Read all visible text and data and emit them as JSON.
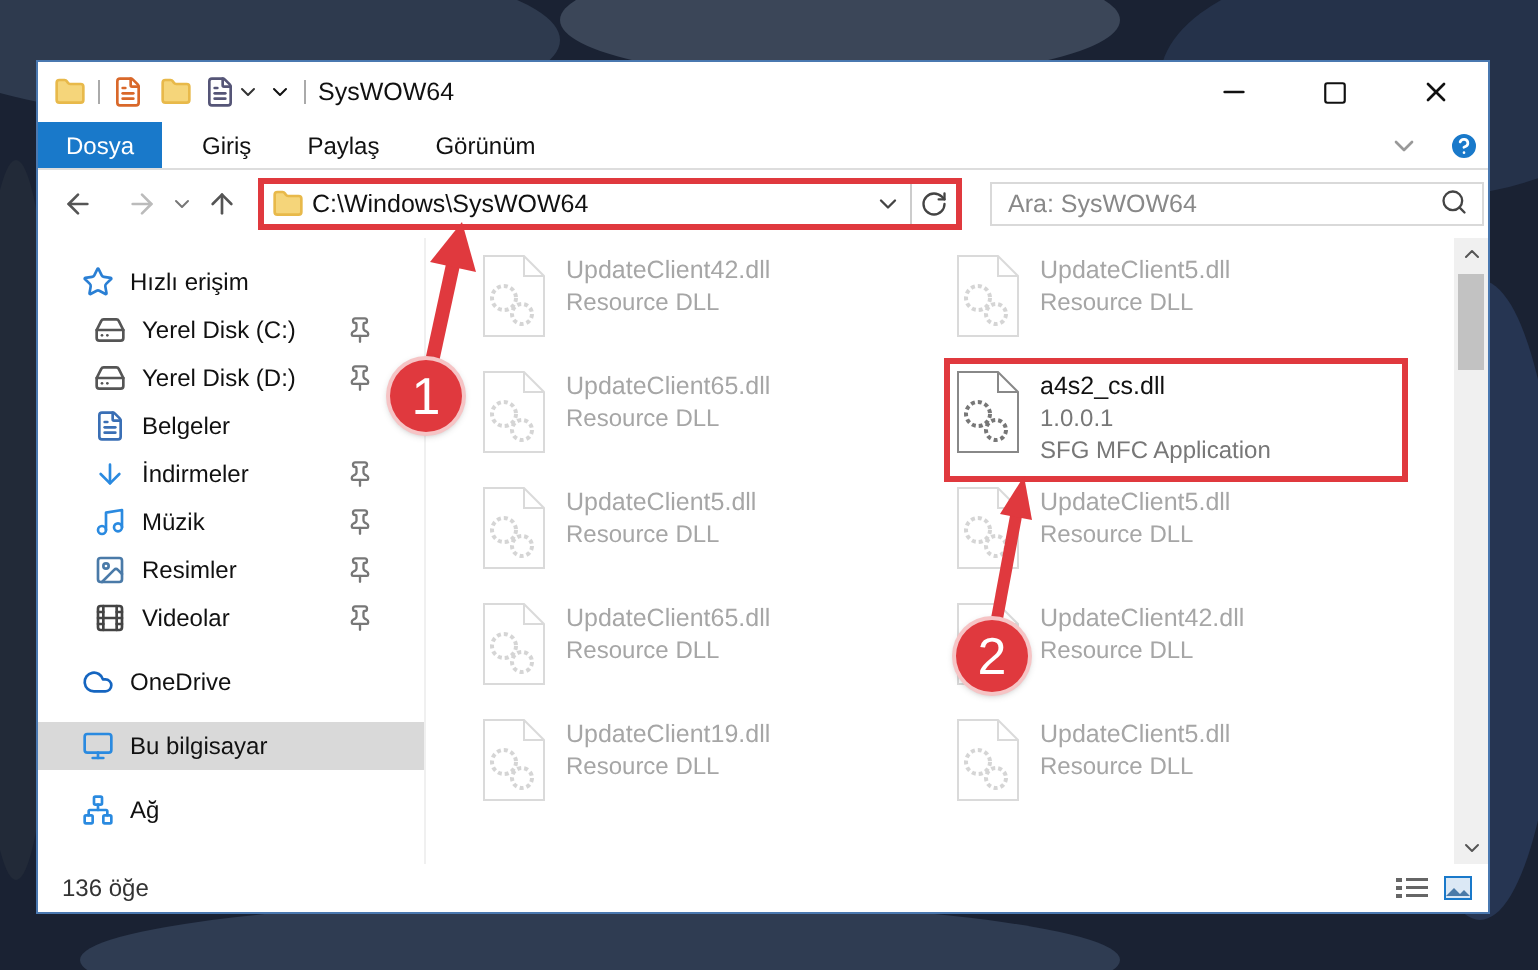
{
  "window": {
    "title": "SysWOW64"
  },
  "ribbon_tabs": [
    {
      "label": "Dosya",
      "selected": true
    },
    {
      "label": "Giriş",
      "selected": false
    },
    {
      "label": "Paylaş",
      "selected": false
    },
    {
      "label": "Görünüm",
      "selected": false
    }
  ],
  "address_bar": {
    "path": "C:\\Windows\\SysWOW64",
    "highlighted": true
  },
  "search": {
    "placeholder": "Ara: SysWOW64"
  },
  "sidebar": {
    "items": [
      {
        "label": "Hızlı erişim",
        "selected": false,
        "children": [
          {
            "label": "Yerel Disk (C:)",
            "pinned": true
          },
          {
            "label": "Yerel Disk (D:)",
            "pinned": true
          },
          {
            "label": "Belgeler"
          },
          {
            "label": "İndirmeler",
            "pinned": true
          },
          {
            "label": "Müzik",
            "pinned": true
          },
          {
            "label": "Resimler",
            "pinned": true
          },
          {
            "label": "Videolar",
            "pinned": true
          }
        ]
      },
      {
        "label": "OneDrive",
        "selected": false
      },
      {
        "label": "Bu bilgisayar",
        "selected": true
      },
      {
        "label": "Ağ",
        "selected": false
      }
    ]
  },
  "files": [
    {
      "name": "UpdateClient42.dll",
      "description": "Resource DLL",
      "faded": true,
      "highlighted": false
    },
    {
      "name": "UpdateClient5.dll",
      "description": "Resource DLL",
      "faded": true,
      "highlighted": false
    },
    {
      "name": "UpdateClient65.dll",
      "description": "Resource DLL",
      "faded": true,
      "highlighted": false
    },
    {
      "name": "a4s2_cs.dll",
      "version": "1.0.0.1",
      "description": "SFG MFC Application",
      "faded": false,
      "highlighted": true
    },
    {
      "name": "UpdateClient5.dll",
      "description": "Resource DLL",
      "faded": true,
      "highlighted": false
    },
    {
      "name": "UpdateClient5.dll",
      "description": "Resource DLL",
      "faded": true,
      "highlighted": false
    },
    {
      "name": "UpdateClient65.dll",
      "description": "Resource DLL",
      "faded": true,
      "highlighted": false
    },
    {
      "name": "UpdateClient42.dll",
      "description": "Resource DLL",
      "faded": true,
      "highlighted": false
    },
    {
      "name": "UpdateClient19.dll",
      "description": "Resource DLL",
      "faded": true,
      "highlighted": false
    },
    {
      "name": "UpdateClient5.dll",
      "description": "Resource DLL",
      "faded": true,
      "highlighted": false
    }
  ],
  "status_bar": {
    "count": "136 öğe"
  },
  "annotations": [
    {
      "number": "1"
    },
    {
      "number": "2"
    }
  ]
}
